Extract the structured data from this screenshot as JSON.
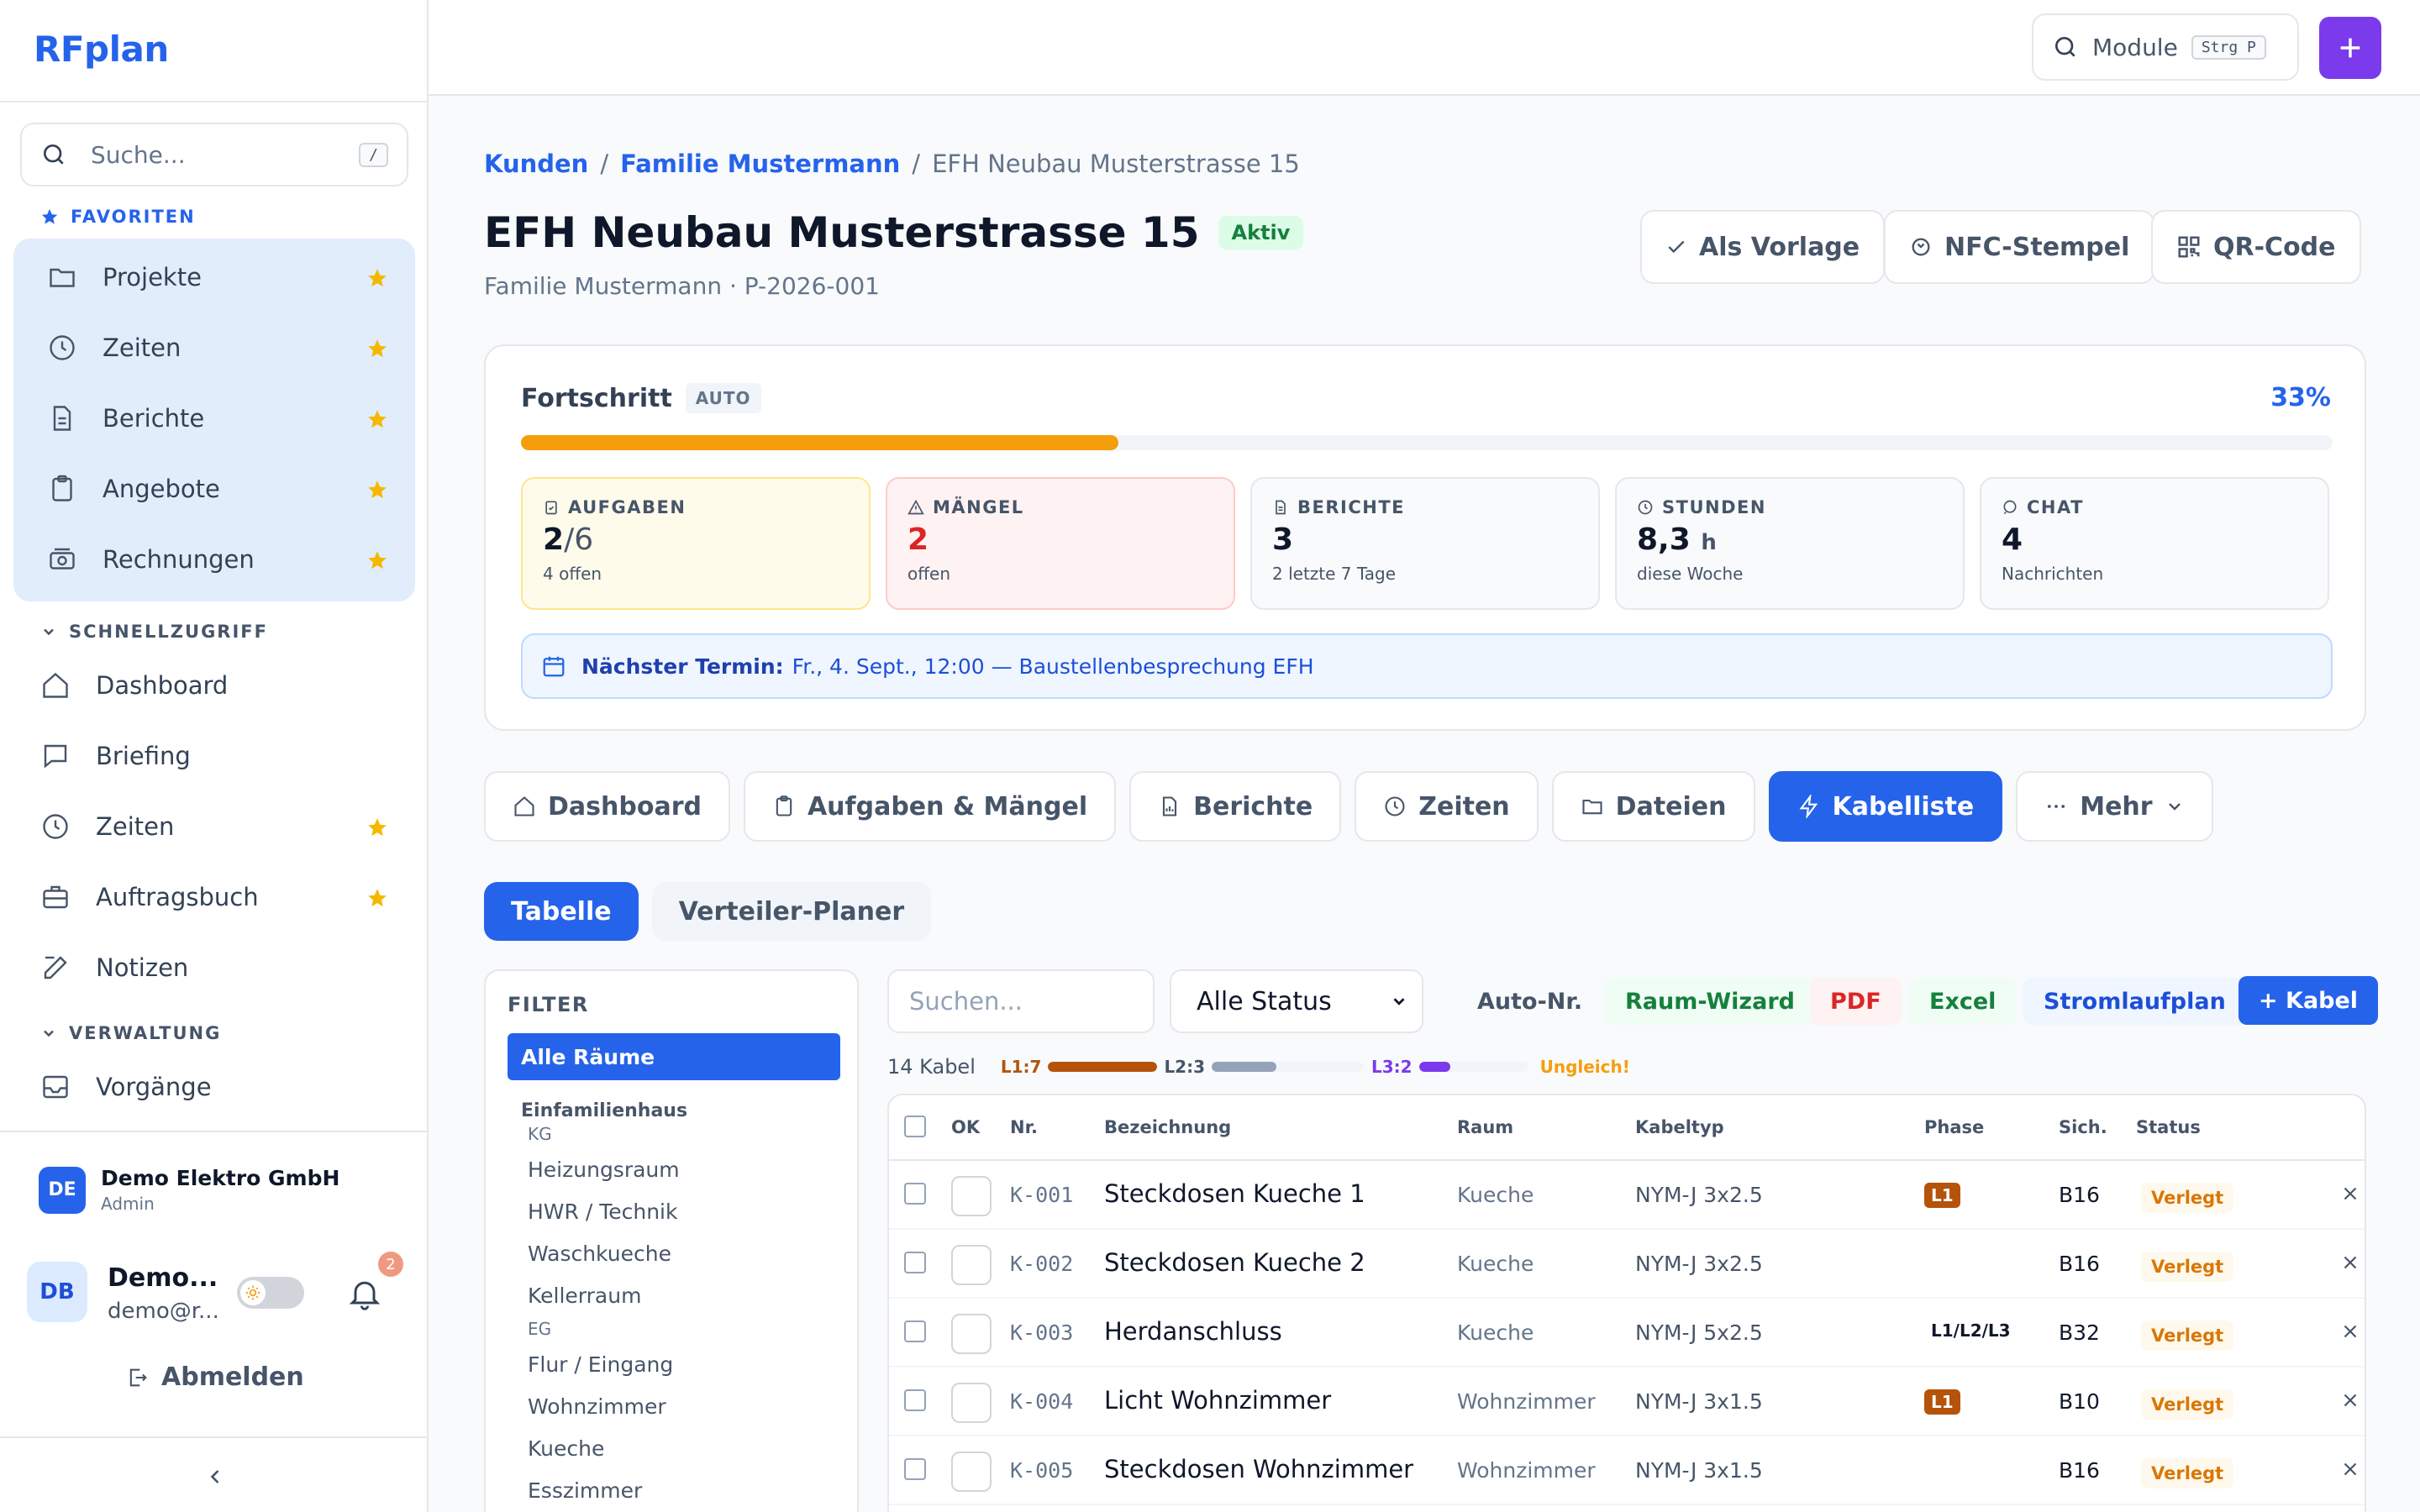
{
  "app": {
    "brand": "RFplan"
  },
  "sidebar": {
    "search_placeholder": "Suche...",
    "search_kbd": "/",
    "favorites_title": "FAVORITEN",
    "favorites": [
      {
        "label": "Projekte",
        "icon": "folder-icon"
      },
      {
        "label": "Zeiten",
        "icon": "clock-icon"
      },
      {
        "label": "Berichte",
        "icon": "document-icon"
      },
      {
        "label": "Angebote",
        "icon": "clipboard-icon"
      },
      {
        "label": "Rechnungen",
        "icon": "cash-icon"
      }
    ],
    "quick_title": "SCHNELLZUGRIFF",
    "quick": [
      {
        "label": "Dashboard",
        "icon": "home-icon",
        "starred": false
      },
      {
        "label": "Briefing",
        "icon": "chat-icon",
        "starred": false
      },
      {
        "label": "Zeiten",
        "icon": "clock-icon",
        "starred": true
      },
      {
        "label": "Auftragsbuch",
        "icon": "briefcase-icon",
        "starred": true
      },
      {
        "label": "Notizen",
        "icon": "edit-icon",
        "starred": false
      }
    ],
    "admin_title": "VERWALTUNG",
    "admin": [
      {
        "label": "Vorgänge",
        "icon": "inbox-icon"
      }
    ],
    "org": {
      "initials": "DE",
      "name": "Demo Elektro GmbH",
      "role": "Admin"
    },
    "user": {
      "initials": "DB",
      "name": "Demo...",
      "email": "demo@r...",
      "notifications": "2"
    },
    "logout": "Abmelden"
  },
  "topbar": {
    "module_label": "Module",
    "module_kbd": "Strg P"
  },
  "breadcrumb": {
    "items": [
      "Kunden",
      "Familie Mustermann"
    ],
    "current": "EFH Neubau Musterstrasse 15"
  },
  "project": {
    "title": "EFH Neubau Musterstrasse 15",
    "status": "Aktiv",
    "subtitle": "Familie Mustermann · P-2026-001",
    "actions": [
      "Als Vorlage",
      "NFC-Stempel",
      "QR-Code"
    ]
  },
  "progress": {
    "label": "Fortschritt",
    "tag": "AUTO",
    "percent_label": "33%",
    "percent": 33,
    "color": "#f59e0b"
  },
  "stats": [
    {
      "label": "AUFGABEN",
      "value": "2",
      "value_suffix": "/6",
      "sub": "4 offen",
      "icon": "clipboard-check-icon"
    },
    {
      "label": "MÄNGEL",
      "value": "2",
      "value_suffix": "",
      "sub": "offen",
      "icon": "warning-icon"
    },
    {
      "label": "BERICHTE",
      "value": "3",
      "value_suffix": "",
      "sub": "2 letzte 7 Tage",
      "icon": "document-icon"
    },
    {
      "label": "STUNDEN",
      "value": "8,3",
      "value_suffix": "h",
      "sub": "diese Woche",
      "icon": "clock-icon"
    },
    {
      "label": "CHAT",
      "value": "4",
      "value_suffix": "",
      "sub": "Nachrichten",
      "icon": "chat-icon"
    }
  ],
  "next_appointment": {
    "label": "Nächster Termin:",
    "text": "Fr., 4. Sept., 12:00 — Baustellenbesprechung EFH"
  },
  "tabs": [
    {
      "label": "Dashboard",
      "icon": "home-icon"
    },
    {
      "label": "Aufgaben & Mängel",
      "icon": "clipboard-icon"
    },
    {
      "label": "Berichte",
      "icon": "report-icon"
    },
    {
      "label": "Zeiten",
      "icon": "clock-icon"
    },
    {
      "label": "Dateien",
      "icon": "folder-icon"
    },
    {
      "label": "Kabelliste",
      "icon": "bolt-icon",
      "active": true
    },
    {
      "label": "Mehr",
      "icon": "more-icon"
    }
  ],
  "subtabs": [
    {
      "label": "Tabelle",
      "active": true
    },
    {
      "label": "Verteiler-Planer"
    }
  ],
  "filter": {
    "title": "FILTER",
    "all": "Alle Räume",
    "house": "Einfamilienhaus",
    "floors": [
      {
        "name": "KG",
        "rooms": [
          "Heizungsraum",
          "HWR / Technik",
          "Waschkueche",
          "Kellerraum"
        ]
      },
      {
        "name": "EG",
        "rooms": [
          "Flur / Eingang",
          "Wohnzimmer",
          "Kueche",
          "Esszimmer"
        ]
      }
    ]
  },
  "toolbar": {
    "search_placeholder": "Suchen...",
    "status_select": "Alle Status",
    "buttons": [
      "Auto-Nr.",
      "Raum-Wizard",
      "PDF",
      "Excel",
      "Stromlaufplan",
      "+ Kabel"
    ]
  },
  "summary": {
    "count": "14 Kabel",
    "phases": [
      {
        "label": "L1:7",
        "value": 7,
        "color": "#b45309"
      },
      {
        "label": "L2:3",
        "value": 3,
        "color": "#94a3b8"
      },
      {
        "label": "L3:2",
        "value": 2,
        "color": "#7c3aed"
      }
    ],
    "max": 7,
    "warning": "Ungleich!"
  },
  "table": {
    "columns": [
      "OK",
      "Nr.",
      "Bezeichnung",
      "Raum",
      "Kabeltyp",
      "Phase",
      "Sich.",
      "Status"
    ],
    "rows": [
      {
        "nr": "K-001",
        "bez": "Steckdosen Kueche 1",
        "raum": "Kueche",
        "typ": "NYM-J 3x2.5",
        "phase": "L1",
        "phase_badge": true,
        "sich": "B16",
        "status": "Verlegt"
      },
      {
        "nr": "K-002",
        "bez": "Steckdosen Kueche 2",
        "raum": "Kueche",
        "typ": "NYM-J 3x2.5",
        "phase": "",
        "phase_badge": false,
        "sich": "B16",
        "status": "Verlegt"
      },
      {
        "nr": "K-003",
        "bez": "Herdanschluss",
        "raum": "Kueche",
        "typ": "NYM-J 5x2.5",
        "phase": "L1/L2/L3",
        "phase_badge": false,
        "sich": "B32",
        "status": "Verlegt"
      },
      {
        "nr": "K-004",
        "bez": "Licht Wohnzimmer",
        "raum": "Wohnzimmer",
        "typ": "NYM-J 3x1.5",
        "phase": "L1",
        "phase_badge": true,
        "sich": "B10",
        "status": "Verlegt"
      },
      {
        "nr": "K-005",
        "bez": "Steckdosen Wohnzimmer",
        "raum": "Wohnzimmer",
        "typ": "NYM-J 3x1.5",
        "phase": "",
        "phase_badge": false,
        "sich": "B16",
        "status": "Verlegt"
      }
    ]
  }
}
